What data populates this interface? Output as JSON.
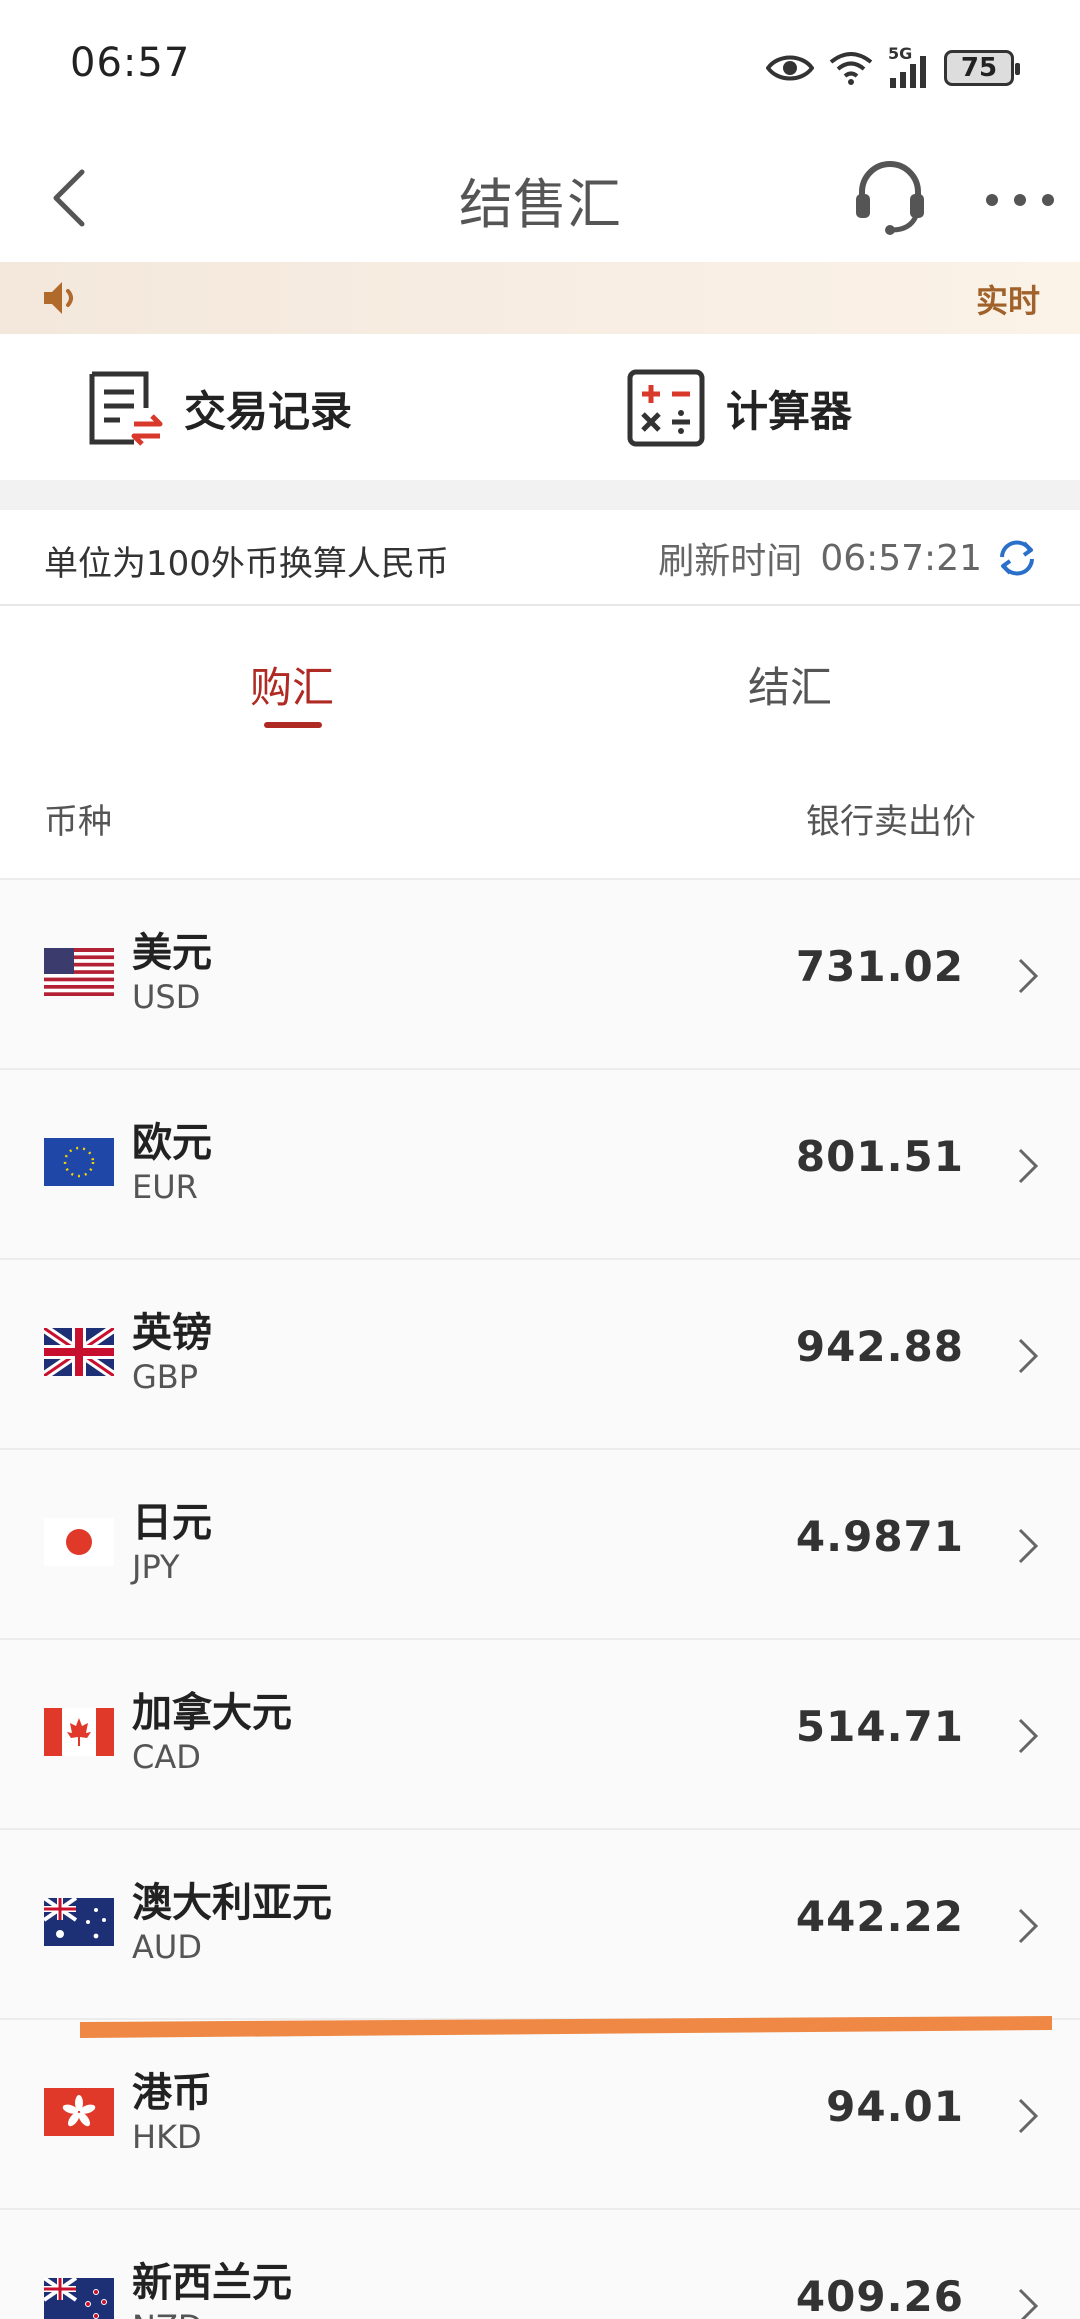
{
  "status": {
    "time": "06:57",
    "battery": "75",
    "network": "5G"
  },
  "nav": {
    "title": "结售汇"
  },
  "notice": {
    "tag": "实时"
  },
  "tools": {
    "records": "交易记录",
    "calculator": "计算器"
  },
  "info": {
    "unit_text": "单位为100外币换算人民币",
    "refresh_label": "刷新时间",
    "refresh_time": "06:57:21"
  },
  "tabs": {
    "buy": "购汇",
    "sell": "结汇",
    "active": "购汇"
  },
  "columns": {
    "currency": "币种",
    "price": "银行卖出价"
  },
  "rates": [
    {
      "name": "美元",
      "code": "USD",
      "price": "731.02"
    },
    {
      "name": "欧元",
      "code": "EUR",
      "price": "801.51"
    },
    {
      "name": "英镑",
      "code": "GBP",
      "price": "942.88"
    },
    {
      "name": "日元",
      "code": "JPY",
      "price": "4.9871"
    },
    {
      "name": "加拿大元",
      "code": "CAD",
      "price": "514.71"
    },
    {
      "name": "澳大利亚元",
      "code": "AUD",
      "price": "442.22"
    },
    {
      "name": "港币",
      "code": "HKD",
      "price": "94.01"
    },
    {
      "name": "新西兰元",
      "code": "NZD",
      "price": "409.26"
    }
  ],
  "colors": {
    "accent": "#b02a24",
    "notice_text": "#a0622a",
    "highlight": "#ee8844",
    "refresh": "#2a6fc9"
  }
}
